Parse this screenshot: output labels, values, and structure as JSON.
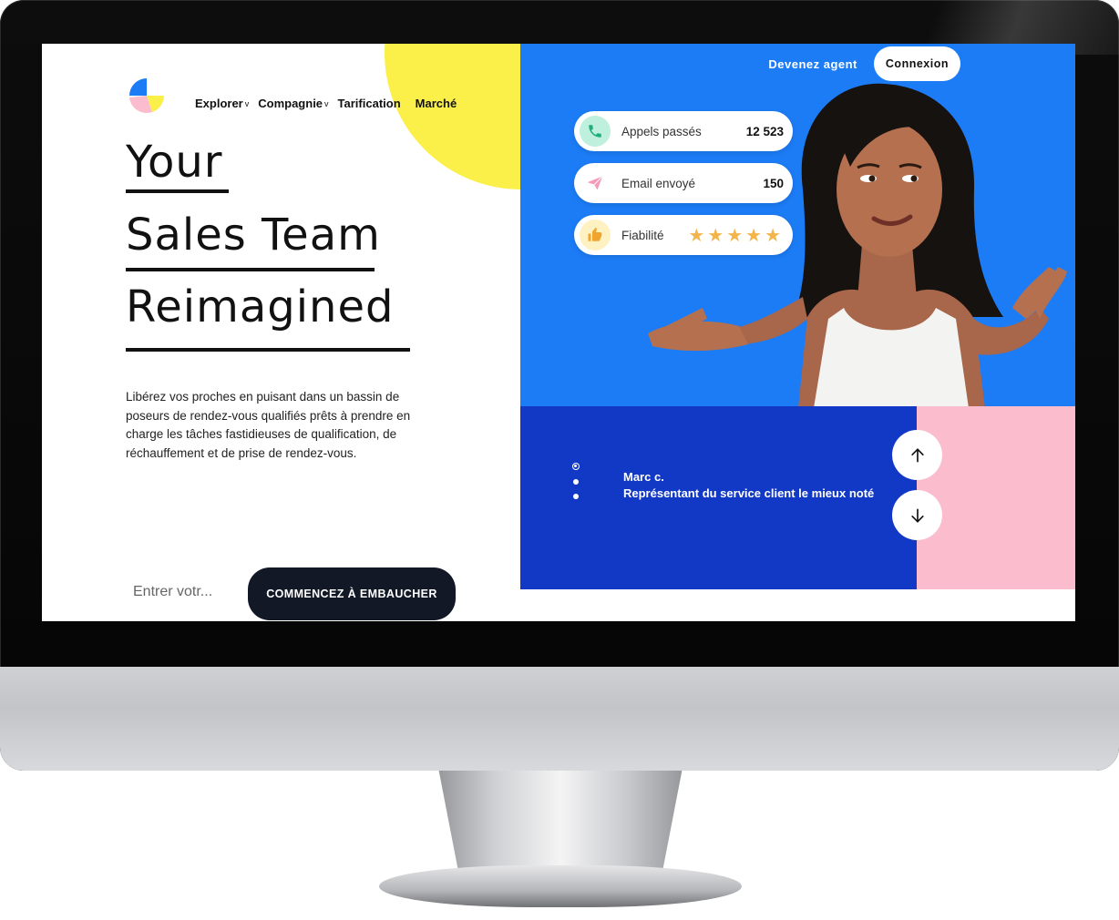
{
  "nav": {
    "items": [
      {
        "label": "Explorer",
        "chevron": "v"
      },
      {
        "label": "Compagnie",
        "chevron": "v"
      },
      {
        "label": "Tarification"
      },
      {
        "label": "Marché"
      }
    ]
  },
  "header": {
    "agent_link": "Devenez agent",
    "login": "Connexion"
  },
  "hero": {
    "headline": [
      "Your",
      "Sales Team",
      "Reimagined"
    ],
    "description": "Libérez vos proches en puisant dans un bassin de poseurs de rendez-vous qualifiés prêts à prendre en charge les tâches fastidieuses de qualification, de réchauffement et de prise de rendez-vous.",
    "email_placeholder": "Entrer votr...",
    "cta": "COMMENCEZ À EMBAUCHER"
  },
  "stats": [
    {
      "label": "Appels passés",
      "value": "12 523",
      "icon": "phone-icon",
      "icon_bg": "#bff0de",
      "icon_color": "#1fae7d"
    },
    {
      "label": "Email envoyé",
      "value": "150",
      "icon": "paper-plane-icon",
      "icon_bg": "#ffffff",
      "icon_color": "#f59ab8"
    },
    {
      "label": "Fiabilité",
      "rating": 5,
      "stars": "★★★★★",
      "icon": "thumbs-up-icon",
      "icon_bg": "#fff2c2",
      "icon_color": "#f0a531"
    }
  ],
  "testimonial": {
    "name": "Marc c.",
    "role": "Représentant du service client le mieux noté",
    "active_index": 0,
    "count": 3
  },
  "colors": {
    "blue": "#1c7cf6",
    "dark_blue": "#1239c6",
    "pink": "#fbbccd",
    "yellow": "#fbf04a",
    "dark": "#121826"
  }
}
